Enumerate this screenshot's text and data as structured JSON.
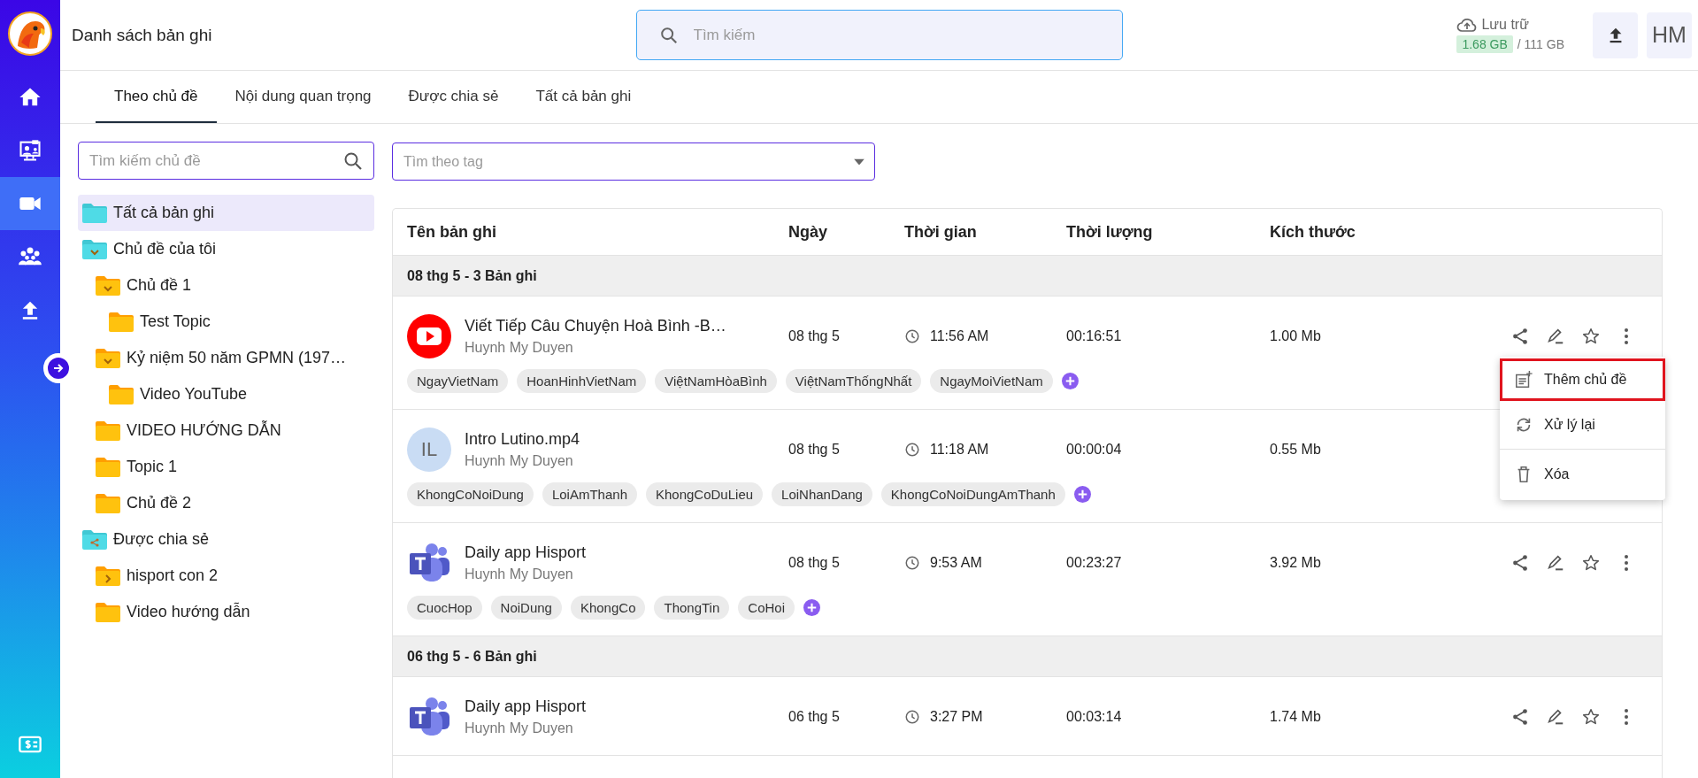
{
  "rail": {
    "items": [
      {
        "kind": "home",
        "selected": false
      },
      {
        "kind": "meeting",
        "selected": false
      },
      {
        "kind": "video",
        "selected": true
      },
      {
        "kind": "people",
        "selected": false
      },
      {
        "kind": "upload",
        "selected": false
      },
      {
        "kind": "billing",
        "selected": false
      }
    ]
  },
  "header": {
    "title": "Danh sách bản ghi",
    "search": {
      "placeholder": "Tìm kiếm"
    },
    "storage": {
      "label": "Lưu trữ",
      "used": "1.68 GB",
      "total": "/ 111 GB"
    },
    "avatar": "HM"
  },
  "tabs": [
    {
      "label": "Theo chủ đề",
      "selected": true
    },
    {
      "label": "Nội dung quan trọng",
      "selected": false
    },
    {
      "label": "Được chia sẻ",
      "selected": false
    },
    {
      "label": "Tất cả bản ghi",
      "selected": false
    }
  ],
  "topic_search": {
    "placeholder": "Tìm kiếm chủ đề"
  },
  "tag_filter": {
    "placeholder": "Tìm theo tag"
  },
  "tree": [
    {
      "label": "Tất cả bản ghi",
      "kind": "all",
      "selected": true
    },
    {
      "label": "Chủ đề của tôi",
      "kind": "mine",
      "selected": false,
      "expanded": true,
      "children": [
        {
          "label": "Chủ đề 1",
          "kind": "folder",
          "selected": false,
          "expanded": true,
          "children": [
            {
              "label": "Test Topic",
              "kind": "folder",
              "selected": false
            }
          ]
        },
        {
          "label": "Kỷ niệm 50 năm GPMN (197…",
          "kind": "folder",
          "selected": false,
          "expanded": true,
          "children": [
            {
              "label": "Video YouTube",
              "kind": "folder",
              "selected": false
            }
          ]
        },
        {
          "label": "VIDEO HƯỚNG DẪN",
          "kind": "folder",
          "selected": false
        },
        {
          "label": "Topic 1",
          "kind": "folder",
          "selected": false
        },
        {
          "label": "Chủ đề 2",
          "kind": "folder",
          "selected": false
        }
      ]
    },
    {
      "label": "Được chia sẻ",
      "kind": "shared",
      "selected": false,
      "children": [
        {
          "label": "hisport con 2",
          "kind": "folder",
          "selected": false,
          "expanded": false
        },
        {
          "label": "Video hướng dẫn",
          "kind": "folder",
          "selected": false
        }
      ]
    }
  ],
  "table": {
    "columns": [
      "Tên bản ghi",
      "Ngày",
      "Thời gian",
      "Thời lượng",
      "Kích thước"
    ],
    "groups": [
      {
        "label": "08 thg 5 - 3 Bản ghi",
        "rows": [
          {
            "kind": "youtube",
            "title": "Viết Tiếp Câu Chuyện Hoà Bình -B…",
            "owner": "Huynh My Duyen",
            "date": "08 thg 5",
            "time": "11:56 AM",
            "duration": "00:16:51",
            "size": "1.00 Mb",
            "tags": [
              "NgayVietNam",
              "HoanHinhVietNam",
              "ViệtNamHòaBình",
              "ViệtNamThốngNhất",
              "NgayMoiVietNam"
            ],
            "menu": [
              {
                "kind": "add-topic",
                "label": "Thêm chủ đề",
                "highlighted": true
              },
              {
                "kind": "reprocess",
                "label": "Xử lý lại",
                "highlighted": false
              },
              {
                "kind": "delete",
                "label": "Xóa",
                "highlighted": false
              }
            ]
          },
          {
            "kind": "initials",
            "initials": "IL",
            "title": "Intro Lutino.mp4",
            "owner": "Huynh My Duyen",
            "date": "08 thg 5",
            "time": "11:18 AM",
            "duration": "00:00:04",
            "size": "0.55 Mb",
            "tags": [
              "KhongCoNoiDung",
              "LoiAmThanh",
              "KhongCoDuLieu",
              "LoiNhanDang",
              "KhongCoNoiDungAmThanh"
            ]
          },
          {
            "kind": "teams",
            "title": "Daily app Hisport",
            "owner": "Huynh My Duyen",
            "date": "08 thg 5",
            "time": "9:53 AM",
            "duration": "00:23:27",
            "size": "3.92 Mb",
            "tags": [
              "CuocHop",
              "NoiDung",
              "KhongCo",
              "ThongTin",
              "CoHoi"
            ]
          }
        ]
      },
      {
        "label": "06 thg 5 - 6 Bản ghi",
        "rows": [
          {
            "kind": "teams",
            "title": "Daily app Hisport",
            "owner": "Huynh My Duyen",
            "date": "06 thg 5",
            "time": "3:27 PM",
            "duration": "00:03:14",
            "size": "1.74 Mb"
          }
        ]
      }
    ]
  }
}
